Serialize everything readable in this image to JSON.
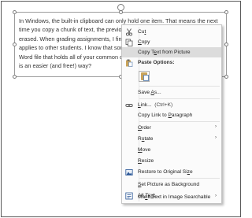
{
  "document": {
    "lines": [
      "In Windows, the built-in clipboard can only hold one item. That means the next",
      "time you copy a chunk of text, the previous",
      "erased. When grading assignments, I find th",
      "applies to other students. I know that some",
      "Word file that holds all of your common co",
      "is an easier (and free!) way?"
    ]
  },
  "context_menu": {
    "cut": {
      "pre": "Cu",
      "u": "t",
      "post": ""
    },
    "copy": {
      "pre": "",
      "u": "C",
      "post": "opy"
    },
    "copy_text": {
      "pre": "Copy T",
      "u": "e",
      "post": "xt from Picture"
    },
    "paste_options_label": "Paste Options:",
    "save_as": {
      "pre": "Save ",
      "u": "A",
      "post": "s..."
    },
    "link": {
      "pre": "",
      "u": "L",
      "post": "ink...",
      "shortcut": "(Ctrl+K)"
    },
    "copy_link": {
      "pre": "Copy Link to ",
      "u": "P",
      "post": "aragraph"
    },
    "order": {
      "pre": "",
      "u": "O",
      "post": "rder"
    },
    "rotate": {
      "pre": "R",
      "u": "o",
      "post": "tate"
    },
    "move": {
      "pre": "",
      "u": "M",
      "post": "ove"
    },
    "resize": {
      "pre": "",
      "u": "R",
      "post": "esize"
    },
    "restore": {
      "pre": "Restore to Original Si",
      "u": "z",
      "post": "e"
    },
    "set_background": {
      "pre": "",
      "u": "S",
      "post": "et Picture as Background"
    },
    "alt_text": {
      "pre": "Alt Te",
      "u": "x",
      "post": "t..."
    },
    "make_searchable": {
      "pre": "Ma",
      "u": "k",
      "post": "e Text in Image Searchable"
    },
    "submenu_arrow": "›"
  },
  "icons": {
    "cut": "scissors-icon",
    "copy": "copy-icon",
    "paste": "paste-icon",
    "paste_keep": "paste-keep-formatting-icon",
    "link": "link-icon",
    "restore": "restore-picture-icon",
    "alt_text": "alt-text-icon"
  },
  "colors": {
    "highlight": "#dcdcdc",
    "menu_bg": "#fbfbfb",
    "icon_blue": "#2b5797"
  }
}
